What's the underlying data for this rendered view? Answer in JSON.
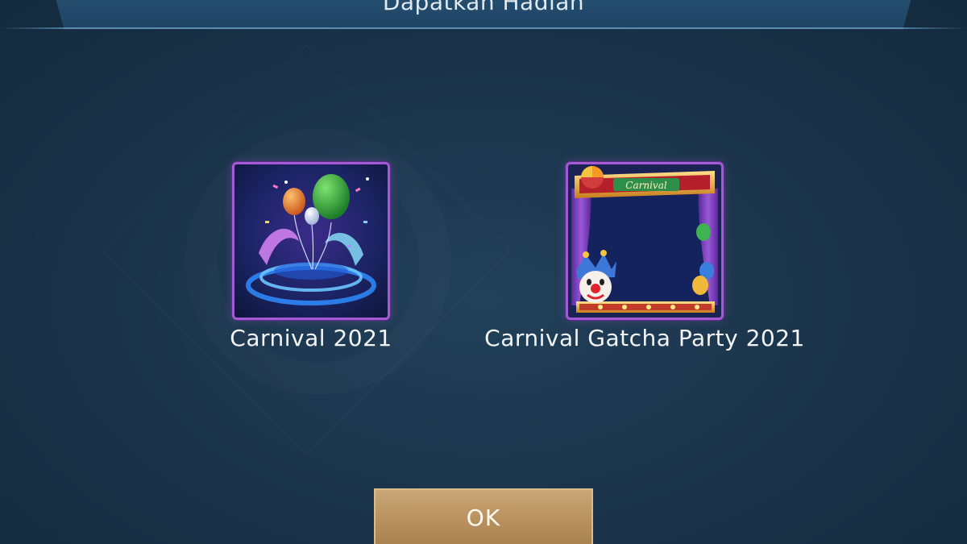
{
  "dialog": {
    "title": "Dapatkan Hadiah",
    "ok_label": "OK"
  },
  "rewards": [
    {
      "label": "Carnival 2021",
      "icon": "balloon-fountain-icon"
    },
    {
      "label": "Carnival Gatcha Party 2021",
      "icon": "carnival-avatar-frame-icon"
    }
  ],
  "colors": {
    "background": "#1a3349",
    "frame_border": "#a45ad6",
    "button": "#b8915e"
  }
}
